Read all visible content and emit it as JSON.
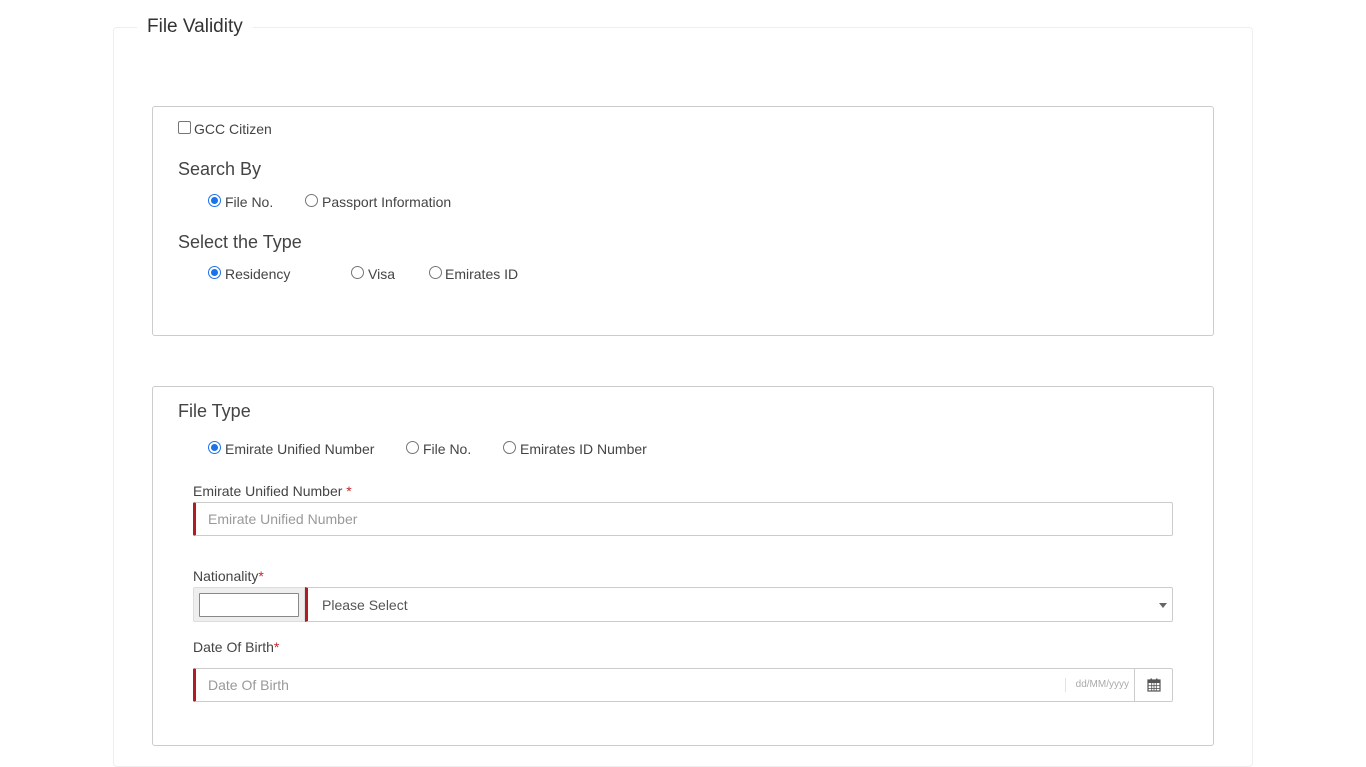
{
  "page": {
    "title": "File Validity"
  },
  "search_panel": {
    "gcc_citizen_label": "GCC Citizen",
    "search_by": {
      "title": "Search By",
      "options": [
        "File No.",
        "Passport Information"
      ],
      "selected": "File No."
    },
    "select_type": {
      "title": "Select the Type",
      "options": [
        "Residency",
        "Visa",
        "Emirates ID"
      ],
      "selected": "Residency"
    }
  },
  "file_type_panel": {
    "title": "File Type",
    "options": [
      "Emirate Unified Number",
      "File No.",
      "Emirates ID Number"
    ],
    "selected": "Emirate Unified Number",
    "unified_number": {
      "label": "Emirate Unified Number",
      "required_mark": "*",
      "placeholder": "Emirate Unified Number"
    },
    "nationality": {
      "label": "Nationality",
      "required_mark": "*",
      "selected_value": "Please Select"
    },
    "date_of_birth": {
      "label": "Date Of Birth",
      "required_mark": "*",
      "placeholder": "Date Of Birth",
      "format_hint": "dd/MM/yyyy"
    }
  },
  "colors": {
    "radio_accent": "#1a73e8",
    "required_accent": "#b01c24"
  }
}
